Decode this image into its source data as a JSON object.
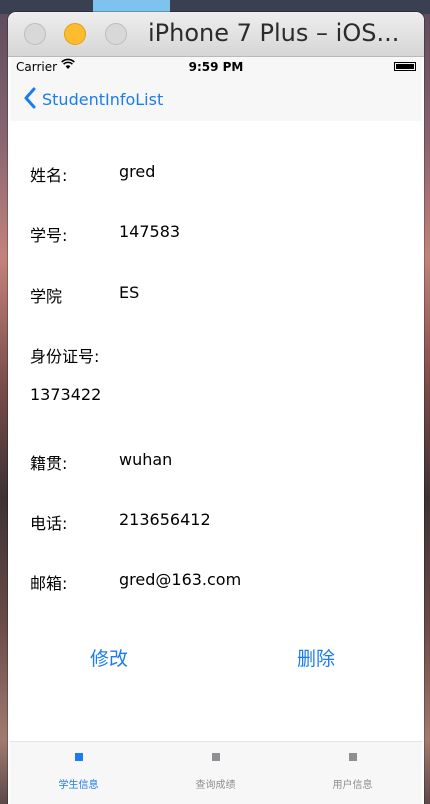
{
  "window": {
    "title": "iPhone 7 Plus – iOS..."
  },
  "status_bar": {
    "carrier": "Carrier",
    "time": "9:59 PM"
  },
  "nav": {
    "back_label": "StudentInfoList"
  },
  "fields": [
    {
      "label": "姓名:",
      "value": "gred"
    },
    {
      "label": "学号:",
      "value": "147583"
    },
    {
      "label": "学院",
      "value": "ES"
    },
    {
      "label": "身份证号:",
      "value": "1373422"
    },
    {
      "label": "籍贯:",
      "value": "wuhan"
    },
    {
      "label": "电话:",
      "value": "213656412"
    },
    {
      "label": "邮箱:",
      "value": "gred@163.com"
    }
  ],
  "actions": {
    "edit_label": "修改",
    "delete_label": "删除"
  },
  "tabs": [
    {
      "label": "学生信息",
      "selected": true
    },
    {
      "label": "查询成绩",
      "selected": false
    },
    {
      "label": "用户信息",
      "selected": false
    }
  ],
  "colors": {
    "accent": "#1a7cf0",
    "tab_inactive": "#8e8e93",
    "tab_active": "#1a7cf0"
  }
}
